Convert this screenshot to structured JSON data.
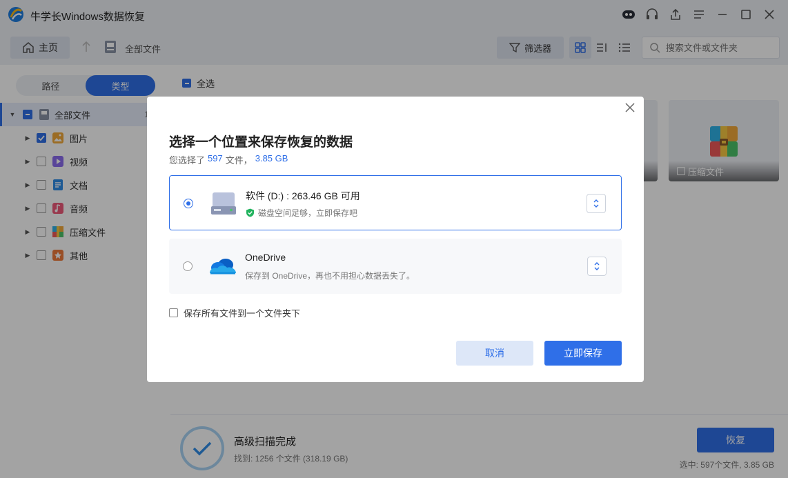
{
  "app": {
    "title": "牛学长Windows数据恢复"
  },
  "toolbar": {
    "home_label": "主页",
    "breadcrumb": "全部文件",
    "filter_label": "筛选器",
    "search_placeholder": "搜索文件或文件夹"
  },
  "sidebar": {
    "tabs": [
      {
        "label": "路径"
      },
      {
        "label": "类型"
      }
    ],
    "active_tab": "类型",
    "tree": {
      "root": {
        "label": "全部文件",
        "count": "1"
      },
      "items": [
        {
          "label": "图片",
          "checked": true
        },
        {
          "label": "视频",
          "checked": false
        },
        {
          "label": "文档",
          "checked": false
        },
        {
          "label": "音频",
          "checked": false
        },
        {
          "label": "压缩文件",
          "checked": false
        },
        {
          "label": "其他",
          "checked": false
        }
      ]
    }
  },
  "main": {
    "select_all_label": "全选",
    "cards": [
      {
        "label": "压缩文件"
      }
    ]
  },
  "status": {
    "scan_title": "高级扫描完成",
    "scan_found": "找到: 1256 个文件 (318.19 GB)",
    "recover_label": "恢复",
    "selected_info": "选中: 597个文件, 3.85 GB"
  },
  "dialog": {
    "title": "选择一个位置来保存恢复的数据",
    "subtitle_prefix": "您选择了",
    "file_count": "597",
    "subtitle_mid": "文件，",
    "size": "3.85 GB",
    "options": [
      {
        "name": "软件 (D:) : 263.46 GB 可用",
        "desc": "磁盘空间足够，立即保存吧",
        "selected": true
      },
      {
        "name": "OneDrive",
        "desc": "保存到 OneDrive，再也不用担心数据丢失了。",
        "selected": false
      }
    ],
    "one_folder_label": "保存所有文件到一个文件夹下",
    "cancel_label": "取消",
    "save_label": "立即保存"
  },
  "colors": {
    "accent": "#2f6fe8",
    "success": "#22b35e"
  }
}
